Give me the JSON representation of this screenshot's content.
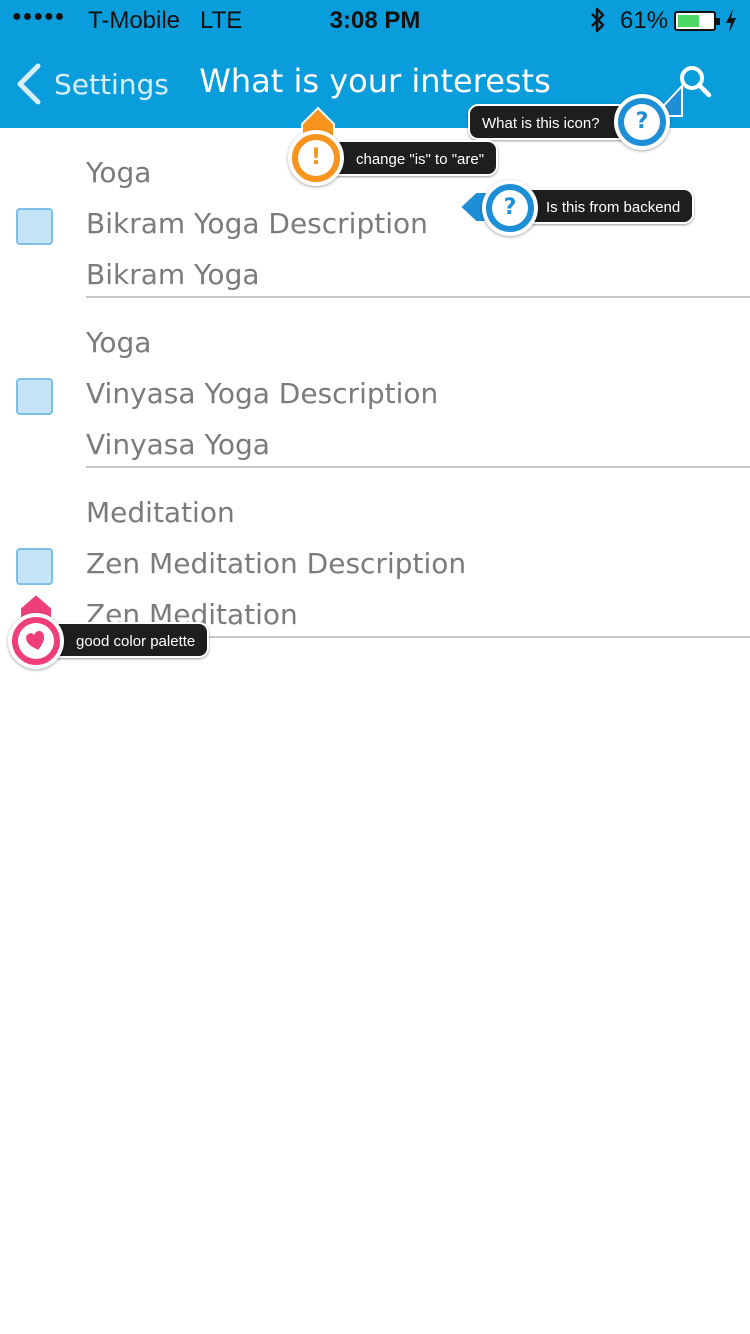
{
  "status": {
    "signal": "●●●●●",
    "carrier": "T-Mobile",
    "network": "LTE",
    "time": "3:08 PM",
    "battery_pct": "61%",
    "battery_level": 0.61
  },
  "nav": {
    "back_label": "Settings",
    "title": "What is your interests",
    "search_icon": "search-icon",
    "color": "#0a9ddb"
  },
  "items": [
    {
      "category": "Yoga",
      "description": "Bikram Yoga Description",
      "name": "Bikram Yoga",
      "checked": false
    },
    {
      "category": "Yoga",
      "description": "Vinyasa Yoga Description",
      "name": "Vinyasa Yoga",
      "checked": false
    },
    {
      "category": "Meditation",
      "description": "Zen Meditation Description",
      "name": "Zen Meditation",
      "checked": false
    }
  ],
  "annotations": {
    "icon_question": "What is this icon?",
    "grammar": "change \"is\" to \"are\"",
    "backend": "Is this from backend",
    "palette": "good color palette",
    "pin_question_mark": "?",
    "pin_exclaim_mark": "!",
    "colors": {
      "blue": "#1e8fd6",
      "orange": "#f7941d",
      "pink": "#ee3f7a"
    }
  }
}
